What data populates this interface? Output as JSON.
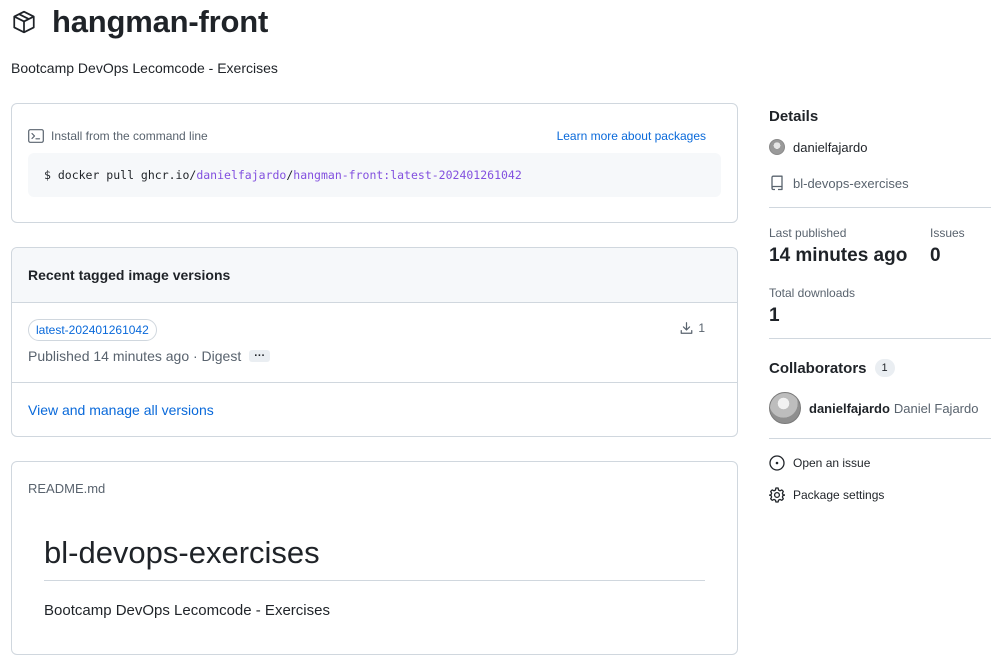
{
  "package": {
    "icon": "package-icon",
    "title": "hangman-front",
    "description": "Bootcamp DevOps Lecomcode - Exercises"
  },
  "install": {
    "icon": "terminal-icon",
    "label": "Install from the command line",
    "learn_more": "Learn more about packages",
    "command_prefix": "$ docker pull ghcr.io/",
    "command_owner": "danielfajardo",
    "command_slash": "/",
    "command_image": "hangman-front:latest-202401261042"
  },
  "versions": {
    "header": "Recent tagged image versions",
    "items": [
      {
        "tag": "latest-202401261042",
        "published": "Published 14 minutes ago · Digest",
        "ellipsis": "···",
        "downloads": "1"
      }
    ],
    "footer_link": "View and manage all versions"
  },
  "readme": {
    "filename": "README.md",
    "heading": "bl-devops-exercises",
    "body": "Bootcamp DevOps Lecomcode - Exercises"
  },
  "sidebar": {
    "details_heading": "Details",
    "owner": "danielfajardo",
    "repository": "bl-devops-exercises",
    "last_published_label": "Last published",
    "last_published_value": "14 minutes ago",
    "issues_label": "Issues",
    "issues_value": "0",
    "total_downloads_label": "Total downloads",
    "total_downloads_value": "1",
    "collaborators_heading": "Collaborators",
    "collaborators_count": "1",
    "collaborators": [
      {
        "login": "danielfajardo",
        "name": "Daniel Fajardo"
      }
    ],
    "open_issue": "Open an issue",
    "package_settings": "Package settings"
  },
  "colors": {
    "link": "#0969da",
    "purple": "#8250df",
    "border": "#d0d7de",
    "muted": "#59636e",
    "text": "#1f2328"
  }
}
